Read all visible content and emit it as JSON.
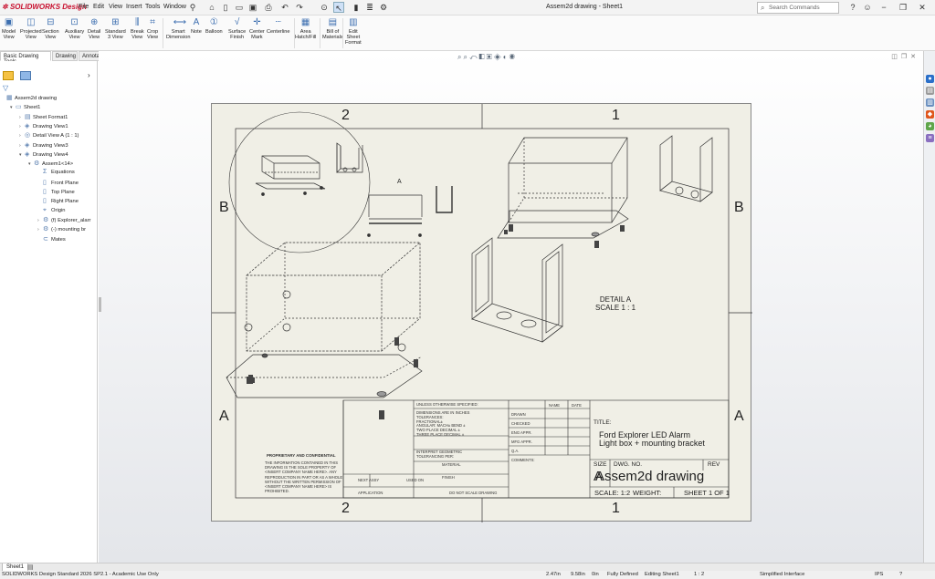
{
  "app": {
    "logo": "SOLIDWORKS Design",
    "document_title": "Assem2d drawing - Sheet1",
    "menus": [
      "File",
      "Edit",
      "View",
      "Insert",
      "Tools",
      "Window"
    ],
    "search_placeholder": "Search Commands"
  },
  "commands": [
    {
      "label": "Model\nView",
      "icon": "model-view-icon"
    },
    {
      "label": "Projected\nView",
      "icon": "projected-view-icon"
    },
    {
      "label": "Section\nView",
      "icon": "section-view-icon"
    },
    {
      "label": "Auxiliary\nView",
      "icon": "auxiliary-view-icon"
    },
    {
      "label": "Detail\nView",
      "icon": "detail-view-icon"
    },
    {
      "label": "Standard\n3 View",
      "icon": "standard-3-view-icon"
    },
    {
      "label": "Break\nView",
      "icon": "break-view-icon"
    },
    {
      "label": "Crop\nView",
      "icon": "crop-view-icon"
    },
    {
      "label": "Smart\nDimension",
      "icon": "smart-dimension-icon"
    },
    {
      "label": "Note",
      "icon": "note-icon"
    },
    {
      "label": "Balloon",
      "icon": "balloon-icon"
    },
    {
      "label": "Surface\nFinish",
      "icon": "surface-finish-icon"
    },
    {
      "label": "Center\nMark",
      "icon": "center-mark-icon"
    },
    {
      "label": "Centerline",
      "icon": "centerline-icon"
    },
    {
      "label": "Area\nHatch/Fill",
      "icon": "area-hatch-icon"
    },
    {
      "label": "Bill of\nMaterials",
      "icon": "bill-of-materials-icon"
    },
    {
      "label": "Edit\nSheet\nFormat",
      "icon": "edit-sheet-format-icon"
    }
  ],
  "tabs": [
    "Basic Drawing Tools",
    "Drawing",
    "Annotation"
  ],
  "tree": [
    {
      "label": "Assem2d drawing",
      "level": 0,
      "toggle": ""
    },
    {
      "label": "Sheet1",
      "level": 1,
      "toggle": "▾"
    },
    {
      "label": "Sheet Format1",
      "level": 2,
      "toggle": "›"
    },
    {
      "label": "Drawing View1",
      "level": 2,
      "toggle": "›"
    },
    {
      "label": "Detail View A (1 : 1)",
      "level": 2,
      "toggle": "›"
    },
    {
      "label": "Drawing View3",
      "level": 2,
      "toggle": "›"
    },
    {
      "label": "Drawing View4",
      "level": 2,
      "toggle": "▾"
    },
    {
      "label": "Assem1<14>",
      "level": 3,
      "toggle": "▾"
    },
    {
      "label": "Equations",
      "level": 4,
      "toggle": ""
    },
    {
      "label": "Front Plane",
      "level": 4,
      "toggle": ""
    },
    {
      "label": "Top Plane",
      "level": 4,
      "toggle": ""
    },
    {
      "label": "Right Plane",
      "level": 4,
      "toggle": ""
    },
    {
      "label": "Origin",
      "level": 4,
      "toggle": ""
    },
    {
      "label": "(f) Explorer_alarr",
      "level": 4,
      "toggle": "›"
    },
    {
      "label": "(-) mounting br",
      "level": 4,
      "toggle": "›"
    },
    {
      "label": "Mates",
      "level": 4,
      "toggle": ""
    }
  ],
  "sheet": {
    "zones_top": [
      "2",
      "1"
    ],
    "zones_bottom": [
      "2",
      "1"
    ],
    "zones_left": [
      "B",
      "A"
    ],
    "zones_right": [
      "B",
      "A"
    ],
    "detail_letter": "A",
    "detail_label": "DETAIL A",
    "detail_scale": "SCALE 1 : 1"
  },
  "title_block": {
    "unless": "UNLESS OTHERWISE SPECIFIED:",
    "name": "NAME",
    "date": "DATE",
    "dims": [
      "DIMENSIONS ARE IN INCHES",
      "TOLERANCES:",
      "FRACTIONAL±",
      "ANGULAR: MACH±   BEND ±",
      "TWO PLACE DECIMAL   ±",
      "THREE PLACE DECIMAL  ±"
    ],
    "roles": [
      "DRAWN",
      "CHECKED",
      "ENG APPR.",
      "MFG APPR.",
      "Q.A.",
      "COMMENTS:"
    ],
    "interpret": [
      "INTERPRET GEOMETRIC",
      "TOLERANCING PER:"
    ],
    "material": "MATERIAL",
    "finish": "FINISH",
    "no_scale": "DO NOT SCALE DRAWING",
    "proprietary_title": "PROPRIETARY AND CONFIDENTIAL",
    "proprietary_text": [
      "THE INFORMATION CONTAINED IN THIS",
      "DRAWING IS THE SOLE PROPERTY OF",
      "<INSERT COMPANY NAME HERE>. ANY",
      "REPRODUCTION IN PART OR AS A WHOLE",
      "WITHOUT THE WRITTEN PERMISSION OF",
      "<INSERT COMPANY NAME HERE> IS",
      "PROHIBITED."
    ],
    "next_assy": "NEXT ASSY",
    "used_on": "USED ON",
    "application": "APPLICATION",
    "title_label": "TITLE:",
    "title_line1": "Ford Explorer LED Alarm",
    "title_line2": "Light box + mounting bracket",
    "size_label": "SIZE",
    "size_value": "A",
    "dwg_no_label": "DWG.  NO.",
    "dwg_no": "Assem2d drawing",
    "rev": "REV",
    "scale": "SCALE: 1:2",
    "weight": "WEIGHT:",
    "sheet_of": "SHEET 1 OF 1"
  },
  "sheet_tab": "Sheet1",
  "status": {
    "product": "SOLIDWORKS Design Standard 2026 SP2.1 - Academic Use Only",
    "x": "2.47in",
    "y": "9.58in",
    "z": "0in",
    "defined": "Fully Defined",
    "editing": "Editing Sheet1",
    "scale": "1 : 2",
    "interface": "Simplified Interface",
    "units": "IPS"
  }
}
